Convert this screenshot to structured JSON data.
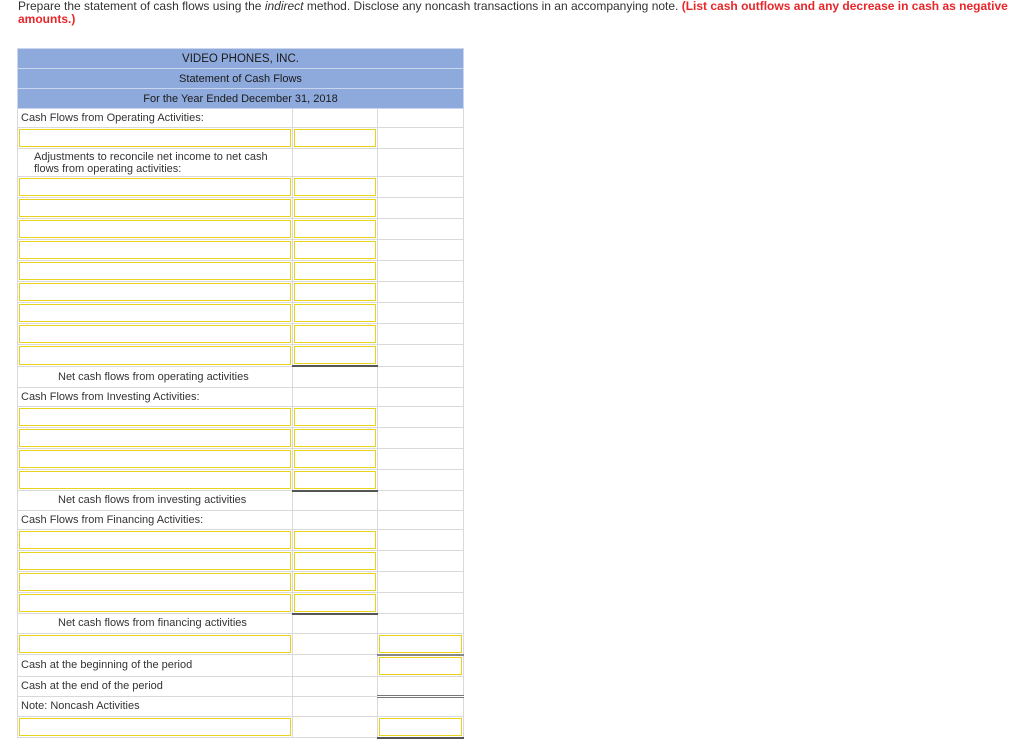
{
  "instructions": {
    "part1": "Prepare the statement of cash flows using the ",
    "italic": "indirect",
    "part2": " method. Disclose any noncash transactions in an accompanying note. ",
    "warning": "(List cash outflows and any decrease in cash as negative amounts.)"
  },
  "header": {
    "company": "VIDEO PHONES, INC.",
    "statement": "Statement of Cash Flows",
    "period": "For the Year Ended December 31, 2018"
  },
  "labels": {
    "operating_heading": "Cash Flows from Operating Activities:",
    "adjustments": "Adjustments to reconcile net income to net cash flows from operating activities:",
    "net_operating": "Net cash flows from operating activities",
    "investing_heading": "Cash Flows from Investing Activities:",
    "net_investing": "Net cash flows from investing activities",
    "financing_heading": "Cash Flows from Financing Activities:",
    "net_financing": "Net cash flows from financing activities",
    "cash_beginning": "Cash at the beginning of the period",
    "cash_end": "Cash at the end of the period",
    "note_noncash": "Note: Noncash Activities"
  },
  "colors": {
    "header_blue": "#8ea9db",
    "input_border": "#e9d21a",
    "warning_red": "#e8262a"
  }
}
